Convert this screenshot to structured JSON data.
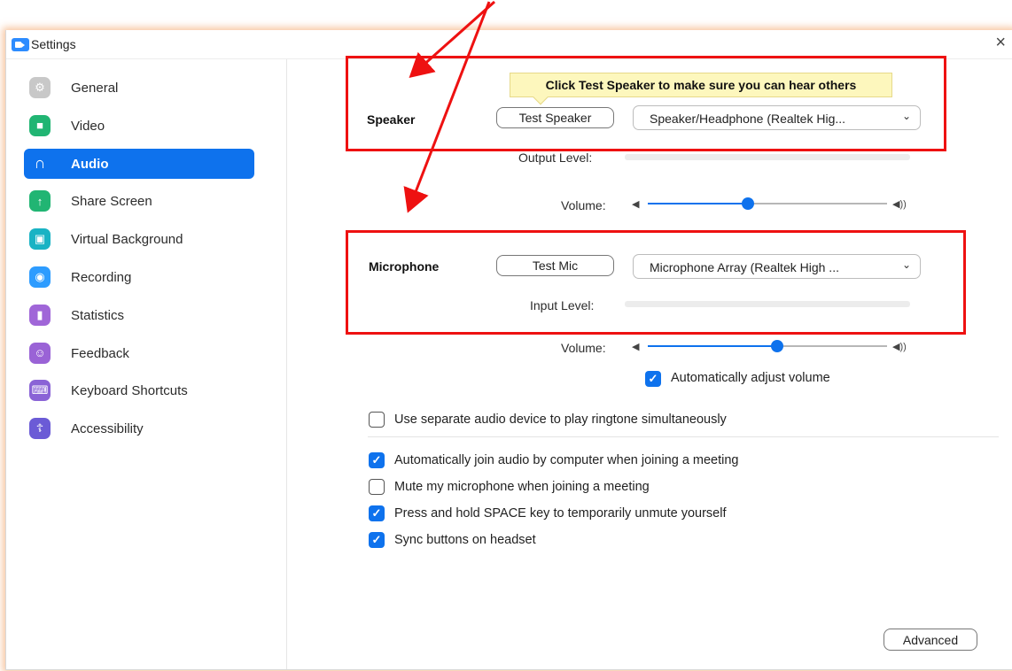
{
  "window": {
    "title": "Settings",
    "close_glyph": "×"
  },
  "sidebar": {
    "items": [
      {
        "label": "General",
        "icon": "gear-icon",
        "color": "#c8c8c8",
        "glyph": "⚙"
      },
      {
        "label": "Video",
        "icon": "video-camera-icon",
        "color": "#21b573",
        "glyph": "■"
      },
      {
        "label": "Audio",
        "icon": "headphones-icon",
        "color": "#0e72ed",
        "glyph": "∩",
        "active": true
      },
      {
        "label": "Share Screen",
        "icon": "share-screen-icon",
        "color": "#21b573",
        "glyph": "↑"
      },
      {
        "label": "Virtual Background",
        "icon": "virtual-background-icon",
        "color": "#19b3c4",
        "glyph": "▣"
      },
      {
        "label": "Recording",
        "icon": "recording-icon",
        "color": "#2d9cff",
        "glyph": "◉"
      },
      {
        "label": "Statistics",
        "icon": "statistics-icon",
        "color": "#a066d8",
        "glyph": "▮"
      },
      {
        "label": "Feedback",
        "icon": "feedback-icon",
        "color": "#9a63d6",
        "glyph": "☺"
      },
      {
        "label": "Keyboard Shortcuts",
        "icon": "keyboard-icon",
        "color": "#8a63d6",
        "glyph": "⌨"
      },
      {
        "label": "Accessibility",
        "icon": "accessibility-icon",
        "color": "#6b5bd6",
        "glyph": "☦"
      }
    ]
  },
  "speaker": {
    "tooltip": "Click Test Speaker to make sure you can hear others",
    "label": "Speaker",
    "test_button": "Test Speaker",
    "device": "Speaker/Headphone (Realtek Hig...",
    "output_level_label": "Output Level:",
    "volume_label": "Volume:",
    "volume_value": 0.42
  },
  "microphone": {
    "label": "Microphone",
    "test_button": "Test Mic",
    "device": "Microphone Array (Realtek High ...",
    "input_level_label": "Input Level:",
    "volume_label": "Volume:",
    "volume_value": 0.54,
    "auto_adjust_label": "Automatically adjust volume",
    "auto_adjust_checked": true
  },
  "options": {
    "separate_ringtone": {
      "label": "Use separate audio device to play ringtone simultaneously",
      "checked": false
    },
    "auto_join": {
      "label": "Automatically join audio by computer when joining a meeting",
      "checked": true
    },
    "mute_on_join": {
      "label": "Mute my microphone when joining a meeting",
      "checked": false
    },
    "space_unmute": {
      "label": "Press and hold SPACE key to temporarily unmute yourself",
      "checked": true
    },
    "sync_headset": {
      "label": "Sync buttons on headset",
      "checked": true
    }
  },
  "advanced_button": "Advanced",
  "colors": {
    "accent": "#0e72ed",
    "annotation_red": "#ee1111",
    "tooltip_bg": "#fdf7bd"
  }
}
